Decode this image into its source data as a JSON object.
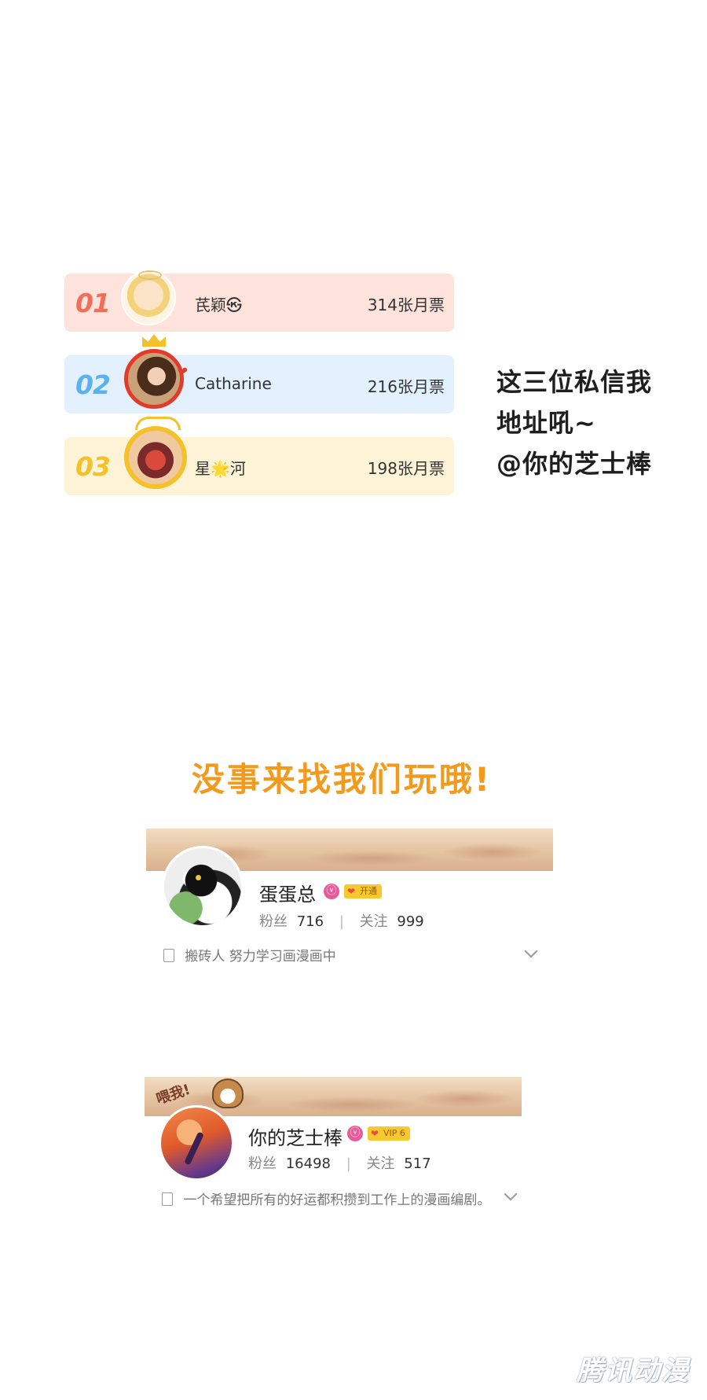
{
  "ranking": [
    {
      "rank": "01",
      "name": "芪颖㉿",
      "votes": "314张月票",
      "bg": "#fde3dc",
      "num_color": "#f26f57"
    },
    {
      "rank": "02",
      "name": "Catharine",
      "votes": "216张月票",
      "bg": "#e3f0fd",
      "num_color": "#5bb2ee"
    },
    {
      "rank": "03",
      "name": "星🌟河",
      "votes": "198张月票",
      "bg": "#fdf3d6",
      "num_color": "#f5c12a"
    }
  ],
  "side_note": "这三位私信我\n地址吼~\n@你的芝士棒",
  "banner_title": "没事来找我们玩哦!",
  "profiles": [
    {
      "name": "蛋蛋总",
      "vip_label": "开通",
      "fans_label": "粉丝",
      "fans": "716",
      "follow_label": "关注",
      "follow": "999",
      "bio": "搬砖人 努力学习画漫画中"
    },
    {
      "name": "你的芝士棒",
      "vip_label": "VIP 6",
      "fans_label": "粉丝",
      "fans": "16498",
      "follow_label": "关注",
      "follow": "517",
      "bio": "一个希望把所有的好运都积攒到工作上的漫画编剧。",
      "sticker_text": "喂我!"
    }
  ],
  "watermark": "腾讯动漫"
}
